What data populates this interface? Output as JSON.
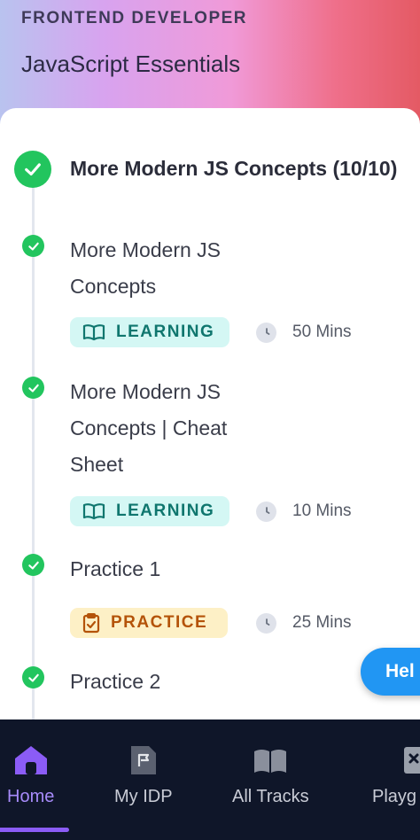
{
  "header": {
    "track_label": "FRONTEND DEVELOPER",
    "course_title": "JavaScript Essentials",
    "gradient_colors": [
      "#b9c3ef",
      "#d8a3ef",
      "#f09ad8",
      "#ef6f8a",
      "#e45a64"
    ]
  },
  "section": {
    "title": "More Modern JS Concepts (10/10)",
    "completed": true
  },
  "items": [
    {
      "title_lines": [
        "More Modern JS",
        "Concepts"
      ],
      "type": "LEARNING",
      "duration": "50 Mins",
      "completed": true
    },
    {
      "title_lines": [
        "More Modern JS",
        "Concepts | Cheat",
        "Sheet"
      ],
      "type": "LEARNING",
      "duration": "10 Mins",
      "completed": true
    },
    {
      "title_lines": [
        "Practice 1"
      ],
      "type": "PRACTICE",
      "duration": "25 Mins",
      "completed": true
    },
    {
      "title_lines": [
        "Practice 2"
      ],
      "completed": true
    }
  ],
  "help_button": {
    "label": "Hel"
  },
  "bottom_nav": {
    "items": [
      {
        "label": "Home",
        "icon": "home-icon",
        "active": true
      },
      {
        "label": "My IDP",
        "icon": "idp-document-icon",
        "active": false
      },
      {
        "label": "All Tracks",
        "icon": "book-open-icon",
        "active": false
      },
      {
        "label": "Playg",
        "icon": "playground-icon",
        "active": false
      }
    ]
  },
  "colors": {
    "complete_green": "#22c55e",
    "learning_bg": "#d4f7f4",
    "learning_text": "#0f766e",
    "practice_bg": "#fdf0c6",
    "practice_text": "#b45309",
    "help_blue": "#2196f3",
    "nav_bg": "#0f1629",
    "nav_active": "#a78bfa"
  }
}
